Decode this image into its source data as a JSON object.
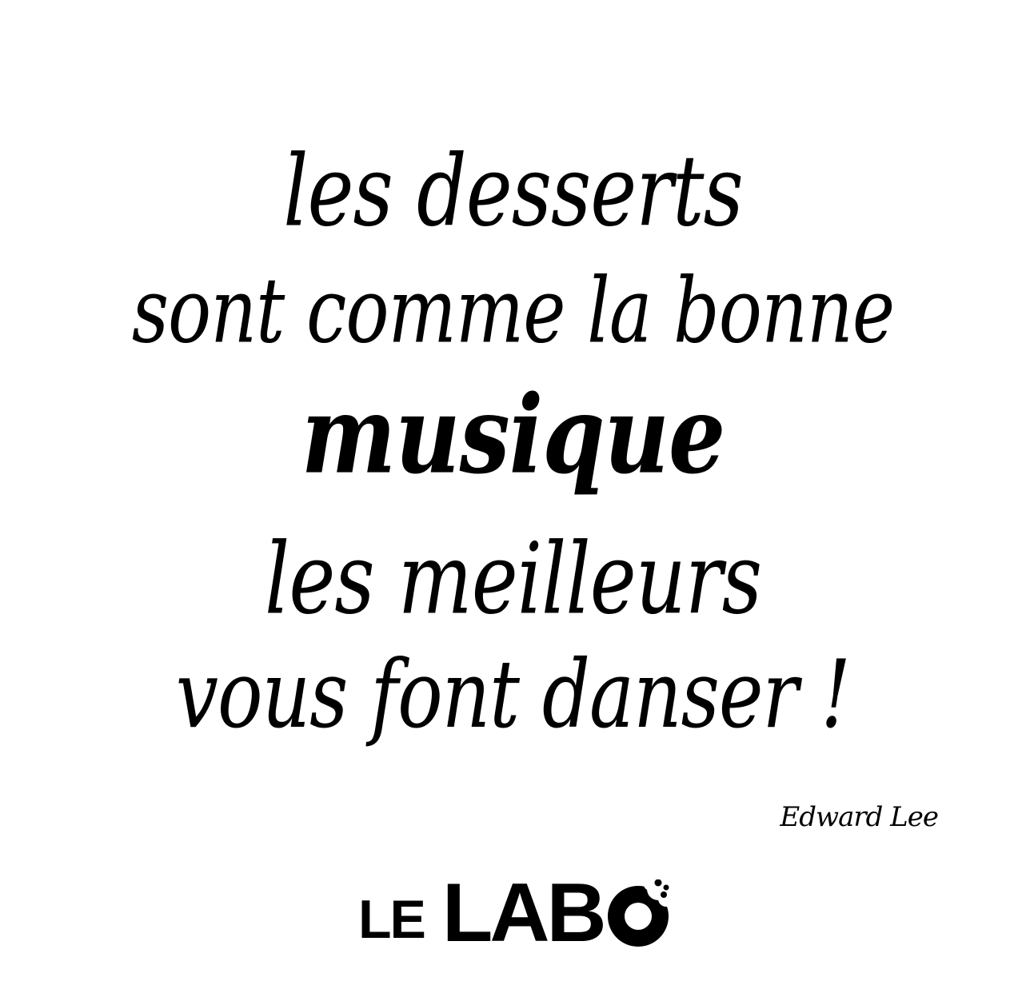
{
  "quote": {
    "line1": "les desserts",
    "line2": "sont comme la bonne",
    "line3": "musique",
    "line4": "les meilleurs",
    "line5": "vous font danser !"
  },
  "author": "Edward Lee",
  "logo": {
    "text_le": "LE",
    "text_lab": "LAB",
    "text_o": "O",
    "color": "#000000"
  },
  "background_color": "#ffffff"
}
